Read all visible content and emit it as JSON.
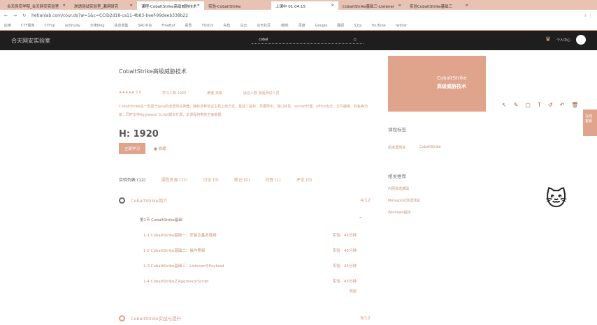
{
  "browser": {
    "tabs": [
      "合天网安学院_合天网安实验室",
      "渗透测试实验室_漏洞研究",
      "课程-CobaltStrike高级威胁技术",
      "实验-CobaltStrike",
      "上课中 01:04:15",
      "CobaltStrike基础三-Listener",
      "实验CobaltStrike基础三"
    ],
    "url": "hetianlab.com/cour.do?w=1&c=CCID2d18-ca11-4b83-beef-99deeb338b22",
    "bookmarks": [
      "应用",
      "CTF题库",
      "CTFsp",
      "setStudy",
      "大佬blog",
      "信息收集",
      "SRC平台",
      "FreeBuf",
      "看雪",
      "TOOLS",
      "先知",
      "乌云",
      "合天社区",
      "i春秋",
      "百度",
      "Google",
      "翻译",
      "52pj",
      "YouTube",
      "twitter"
    ]
  },
  "header": {
    "logo": "合天网安实验室",
    "search_value": "cobal",
    "user": "个人中心"
  },
  "course": {
    "title": "CobaltStrike高级威胁技术",
    "meta": [
      "★★★★★ 5.0",
      "学习人数 1920",
      "难度 高级",
      "适合人群 渗透测试人员"
    ],
    "description": "CobaltStrike是一款基于Java的渗透测试神器，拥有多种协议主机上线方式，集成了提权、凭据导出、端口转发、socket代理、office攻击、文件捆绑、钓鱼等功能，同时支持Aggressor Script脚本扩展，本课程将带你全面掌握。",
    "price": "H: 1920",
    "learn_button": "立即学习",
    "favorite": "收藏"
  },
  "course_tabs": [
    "实验列表 (12)",
    "课程资源 (12)",
    "讨论 (0)",
    "笔记 (0)",
    "问答 (1)",
    "评论 (0)"
  ],
  "chapters": [
    {
      "title": "CobaltStrike简介",
      "count": "4/12",
      "section": "第1节 CobaltStrike基础",
      "lessons": [
        {
          "name": "1-1 CobaltStrike基础一：安装及基本使用",
          "meta": "实验 · 45分钟"
        },
        {
          "name": "1-2 CobaltStrike基础二：操作界面",
          "meta": "实验 · 45分钟"
        },
        {
          "name": "1-3 CobaltStrike基础三：Listener与Payload",
          "meta": "实验 · 45分钟"
        },
        {
          "name": "1-4 CobaltStrike之AggressorScript",
          "meta": "实验 · 45分钟"
        }
      ],
      "more": "收起"
    },
    {
      "title": "CobaltStrike实战与提升",
      "count": "8/12"
    }
  ],
  "sidebar": {
    "banner": [
      "CobaltStrike",
      "高级威胁技术"
    ],
    "tags_title": "课程标签",
    "tags": [
      "后渗透测试",
      "CobaltStrike"
    ],
    "related_title": "相关推荐",
    "related": [
      "内网渗透基础",
      "Metasploit渗透测试",
      "Windows提权"
    ]
  },
  "float": {
    "tab": "在线客服"
  }
}
